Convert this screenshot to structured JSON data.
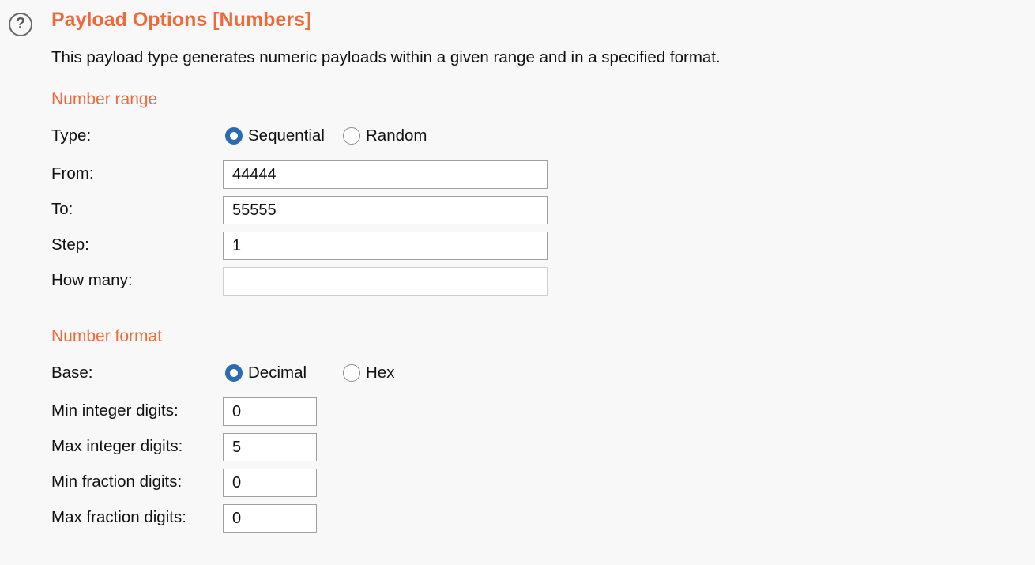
{
  "header": {
    "help_icon_glyph": "?",
    "title": "Payload Options [Numbers]",
    "description": "This payload type generates numeric payloads within a given range and in a specified format."
  },
  "number_range": {
    "heading": "Number range",
    "type_label": "Type:",
    "type_options": [
      {
        "label": "Sequential",
        "selected": true
      },
      {
        "label": "Random",
        "selected": false
      }
    ],
    "from_label": "From:",
    "from_value": "44444",
    "to_label": "To:",
    "to_value": "55555",
    "step_label": "Step:",
    "step_value": "1",
    "how_many_label": "How many:",
    "how_many_value": ""
  },
  "number_format": {
    "heading": "Number format",
    "base_label": "Base:",
    "base_options": [
      {
        "label": "Decimal",
        "selected": true
      },
      {
        "label": "Hex",
        "selected": false
      }
    ],
    "min_integer_label": "Min integer digits:",
    "min_integer_value": "0",
    "max_integer_label": "Max integer digits:",
    "max_integer_value": "5",
    "min_fraction_label": "Min fraction digits:",
    "min_fraction_value": "0",
    "max_fraction_label": "Max fraction digits:",
    "max_fraction_value": "0"
  },
  "colors": {
    "accent": "#ee6a3b",
    "radio_selected": "#2b6cb0",
    "background": "#f8f8f8"
  }
}
